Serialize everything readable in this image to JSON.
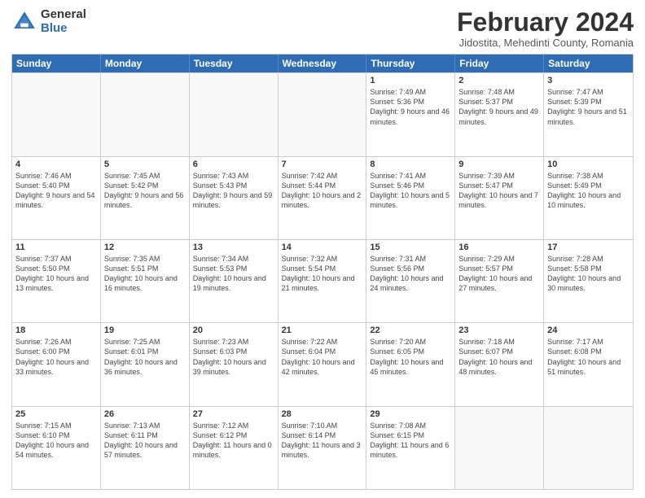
{
  "logo": {
    "general": "General",
    "blue": "Blue"
  },
  "title": "February 2024",
  "location": "Jidostita, Mehedinti County, Romania",
  "header_days": [
    "Sunday",
    "Monday",
    "Tuesday",
    "Wednesday",
    "Thursday",
    "Friday",
    "Saturday"
  ],
  "rows": [
    [
      {
        "day": "",
        "info": ""
      },
      {
        "day": "",
        "info": ""
      },
      {
        "day": "",
        "info": ""
      },
      {
        "day": "",
        "info": ""
      },
      {
        "day": "1",
        "info": "Sunrise: 7:49 AM\nSunset: 5:36 PM\nDaylight: 9 hours and 46 minutes."
      },
      {
        "day": "2",
        "info": "Sunrise: 7:48 AM\nSunset: 5:37 PM\nDaylight: 9 hours and 49 minutes."
      },
      {
        "day": "3",
        "info": "Sunrise: 7:47 AM\nSunset: 5:39 PM\nDaylight: 9 hours and 51 minutes."
      }
    ],
    [
      {
        "day": "4",
        "info": "Sunrise: 7:46 AM\nSunset: 5:40 PM\nDaylight: 9 hours and 54 minutes."
      },
      {
        "day": "5",
        "info": "Sunrise: 7:45 AM\nSunset: 5:42 PM\nDaylight: 9 hours and 56 minutes."
      },
      {
        "day": "6",
        "info": "Sunrise: 7:43 AM\nSunset: 5:43 PM\nDaylight: 9 hours and 59 minutes."
      },
      {
        "day": "7",
        "info": "Sunrise: 7:42 AM\nSunset: 5:44 PM\nDaylight: 10 hours and 2 minutes."
      },
      {
        "day": "8",
        "info": "Sunrise: 7:41 AM\nSunset: 5:46 PM\nDaylight: 10 hours and 5 minutes."
      },
      {
        "day": "9",
        "info": "Sunrise: 7:39 AM\nSunset: 5:47 PM\nDaylight: 10 hours and 7 minutes."
      },
      {
        "day": "10",
        "info": "Sunrise: 7:38 AM\nSunset: 5:49 PM\nDaylight: 10 hours and 10 minutes."
      }
    ],
    [
      {
        "day": "11",
        "info": "Sunrise: 7:37 AM\nSunset: 5:50 PM\nDaylight: 10 hours and 13 minutes."
      },
      {
        "day": "12",
        "info": "Sunrise: 7:35 AM\nSunset: 5:51 PM\nDaylight: 10 hours and 16 minutes."
      },
      {
        "day": "13",
        "info": "Sunrise: 7:34 AM\nSunset: 5:53 PM\nDaylight: 10 hours and 19 minutes."
      },
      {
        "day": "14",
        "info": "Sunrise: 7:32 AM\nSunset: 5:54 PM\nDaylight: 10 hours and 21 minutes."
      },
      {
        "day": "15",
        "info": "Sunrise: 7:31 AM\nSunset: 5:56 PM\nDaylight: 10 hours and 24 minutes."
      },
      {
        "day": "16",
        "info": "Sunrise: 7:29 AM\nSunset: 5:57 PM\nDaylight: 10 hours and 27 minutes."
      },
      {
        "day": "17",
        "info": "Sunrise: 7:28 AM\nSunset: 5:58 PM\nDaylight: 10 hours and 30 minutes."
      }
    ],
    [
      {
        "day": "18",
        "info": "Sunrise: 7:26 AM\nSunset: 6:00 PM\nDaylight: 10 hours and 33 minutes."
      },
      {
        "day": "19",
        "info": "Sunrise: 7:25 AM\nSunset: 6:01 PM\nDaylight: 10 hours and 36 minutes."
      },
      {
        "day": "20",
        "info": "Sunrise: 7:23 AM\nSunset: 6:03 PM\nDaylight: 10 hours and 39 minutes."
      },
      {
        "day": "21",
        "info": "Sunrise: 7:22 AM\nSunset: 6:04 PM\nDaylight: 10 hours and 42 minutes."
      },
      {
        "day": "22",
        "info": "Sunrise: 7:20 AM\nSunset: 6:05 PM\nDaylight: 10 hours and 45 minutes."
      },
      {
        "day": "23",
        "info": "Sunrise: 7:18 AM\nSunset: 6:07 PM\nDaylight: 10 hours and 48 minutes."
      },
      {
        "day": "24",
        "info": "Sunrise: 7:17 AM\nSunset: 6:08 PM\nDaylight: 10 hours and 51 minutes."
      }
    ],
    [
      {
        "day": "25",
        "info": "Sunrise: 7:15 AM\nSunset: 6:10 PM\nDaylight: 10 hours and 54 minutes."
      },
      {
        "day": "26",
        "info": "Sunrise: 7:13 AM\nSunset: 6:11 PM\nDaylight: 10 hours and 57 minutes."
      },
      {
        "day": "27",
        "info": "Sunrise: 7:12 AM\nSunset: 6:12 PM\nDaylight: 11 hours and 0 minutes."
      },
      {
        "day": "28",
        "info": "Sunrise: 7:10 AM\nSunset: 6:14 PM\nDaylight: 11 hours and 3 minutes."
      },
      {
        "day": "29",
        "info": "Sunrise: 7:08 AM\nSunset: 6:15 PM\nDaylight: 11 hours and 6 minutes."
      },
      {
        "day": "",
        "info": ""
      },
      {
        "day": "",
        "info": ""
      }
    ]
  ]
}
